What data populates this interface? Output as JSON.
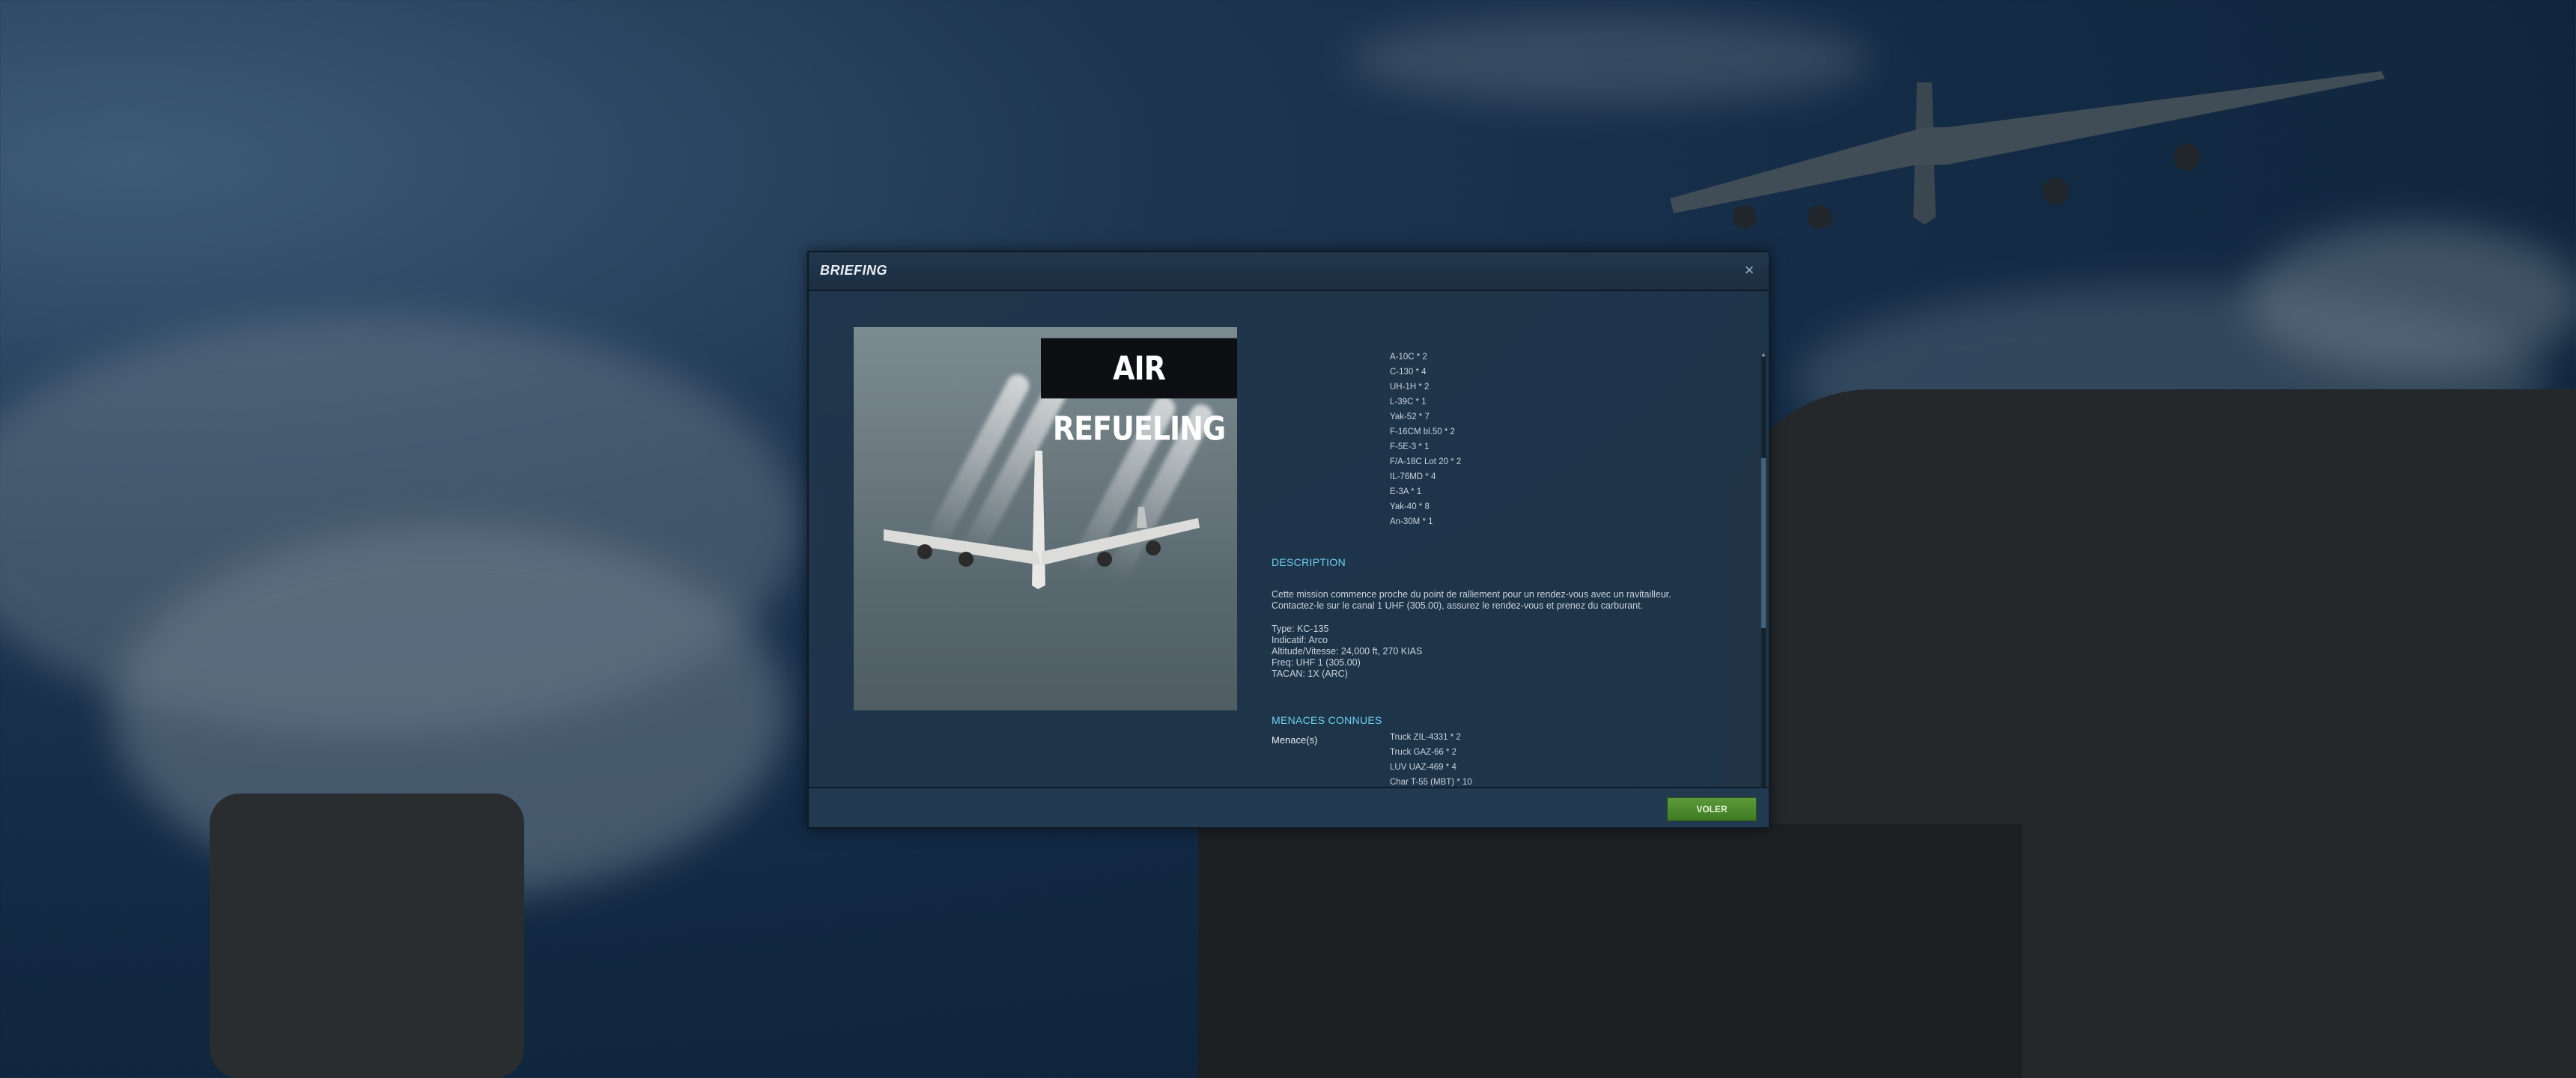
{
  "dialog": {
    "title": "BRIEFING",
    "close_label": "×"
  },
  "mission_image": {
    "banner_text": "AIR REFUELING"
  },
  "units": [
    "A-10C * 2",
    "C-130 * 4",
    "UH-1H * 2",
    "L-39C * 1",
    "Yak-52 * 7",
    "F-16CM bl.50 * 2",
    "F-5E-3 * 1",
    "F/A-18C Lot 20 * 2",
    "IL-76MD * 4",
    "E-3A * 1",
    "Yak-40 * 8",
    "An-30M * 1"
  ],
  "description": {
    "heading": "DESCRIPTION",
    "paragraph": [
      "Cette mission commence proche du point de ralliement pour un rendez-vous avec un ravitailleur.",
      "Contactez-le sur le canal 1 UHF (305.00), assurez le rendez-vous et prenez du carburant."
    ],
    "details": [
      "Type: KC-135",
      "Indicatif: Arco",
      "Altitude/Vitesse: 24,000 ft, 270 KIAS",
      "Freq: UHF 1 (305.00)",
      "TACAN: 1X (ARC)"
    ]
  },
  "threats": {
    "heading": "MENACES CONNUES",
    "label": "Menace(s)",
    "items": [
      "Truck ZIL-4331 * 2",
      "Truck GAZ-66 * 2",
      "LUV UAZ-469 * 4",
      "Char T-55 (MBT) * 10"
    ]
  },
  "footer": {
    "fly_button": "VOLER"
  },
  "colors": {
    "accent": "#6ed0f0",
    "fly_button": "#4f8a2e",
    "dialog_bg": "#20364a"
  }
}
